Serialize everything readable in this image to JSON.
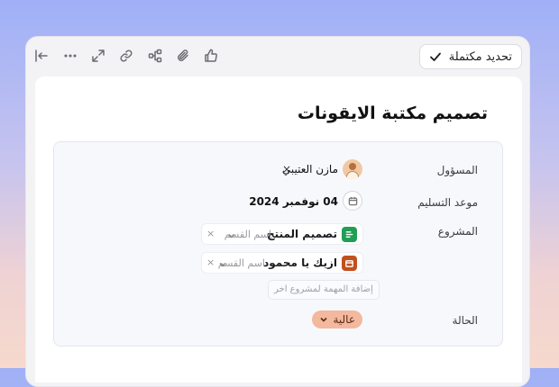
{
  "toolbar": {
    "complete_label": "تحديد مكتملة",
    "icons": [
      "collapse-icon",
      "more-icon",
      "expand-icon",
      "link-icon",
      "share-icon",
      "attachment-icon",
      "like-icon"
    ]
  },
  "task": {
    "title": "تصميم مكتبة الايقونات",
    "fields": {
      "assignee_label": "المسؤول",
      "assignee_name": "مازن العتيبي",
      "assignee_remove": "×",
      "due_label": "موعد التسليم",
      "due_value": "04 نوفمبر 2024",
      "project_label": "المشروع",
      "status_label": "الحالة"
    },
    "projects": [
      {
        "name": "تصميم المنتج",
        "section_placeholder": "اسم القسم",
        "remove": "×",
        "color": "#1f9e54"
      },
      {
        "name": "ازيك يا محمود",
        "section_placeholder": "اسم القسم",
        "remove": "×",
        "color": "#c2501e"
      }
    ],
    "add_project_label": "إضافة المهمة لمشروع اخر",
    "status_value": "عالية",
    "status_color": "#f3b89d"
  }
}
